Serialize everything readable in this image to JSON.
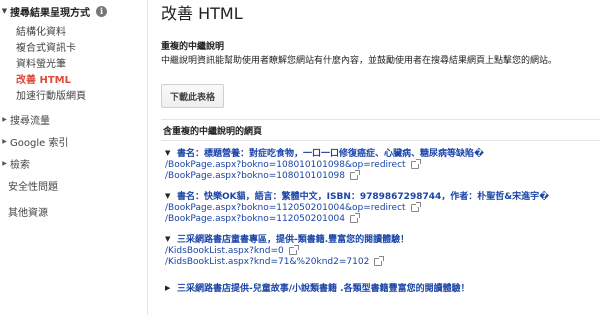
{
  "sidebar": {
    "section_title": "搜尋結果呈現方式",
    "section_items": [
      {
        "label": "結構化資料",
        "active": false
      },
      {
        "label": "複合式資訊卡",
        "active": false
      },
      {
        "label": "資料螢光筆",
        "active": false
      },
      {
        "label": "改善 HTML",
        "active": true
      },
      {
        "label": "加速行動版網頁",
        "active": false
      }
    ],
    "collapsed_sections": [
      {
        "label": "搜尋流量"
      },
      {
        "label": "Google 索引"
      },
      {
        "label": "檢索"
      }
    ],
    "plain_items": [
      {
        "label": "安全性問題"
      },
      {
        "label": "其他資源"
      }
    ]
  },
  "main": {
    "title": "改善 HTML",
    "section_heading": "重複的中繼說明",
    "section_description": "中繼說明資訊能幫助使用者瞭解您網站有什麼內容，並鼓勵使用者在搜尋結果網頁上點擊您的網站。",
    "download_button": "下載此表格",
    "table_header": "含重複的中繼說明的網頁",
    "groups": [
      {
        "title": "書名：標題營養：對症吃食物，一口一口修復癌症、心臟病、糖尿病等缺陷�",
        "expanded": true,
        "urls": [
          "/BookPage.aspx?bokno=108010101098&op=redirect",
          "/BookPage.aspx?bokno=108010101098"
        ]
      },
      {
        "title": "書名：快樂OK貓，語言：繁體中文，ISBN：9789867298744，作者：朴聖哲&宋進宇�",
        "expanded": true,
        "urls": [
          "/BookPage.aspx?bokno=112050201004&op=redirect",
          "/BookPage.aspx?bokno=112050201004"
        ]
      },
      {
        "title": "三采網路書店童書專區，提供-類書籍.豐富您的閱讀體驗！",
        "expanded": true,
        "urls": [
          "/KidsBookList.aspx?knd=0",
          "/KidsBookList.aspx?knd=71&%20knd2=7102"
        ]
      },
      {
        "title": "三采網路書店提供-兒童故事/小說類書籍 .各類型書籍豐富您的閱讀體驗！",
        "expanded": false,
        "urls": []
      }
    ]
  },
  "icons": {
    "info": "info-icon",
    "external_link": "external-link-icon",
    "expanded_triangle": "triangle-down-icon",
    "collapsed_triangle": "triangle-right-icon"
  },
  "colors": {
    "active_nav": "#dd4b39",
    "link": "#1a44a8"
  }
}
